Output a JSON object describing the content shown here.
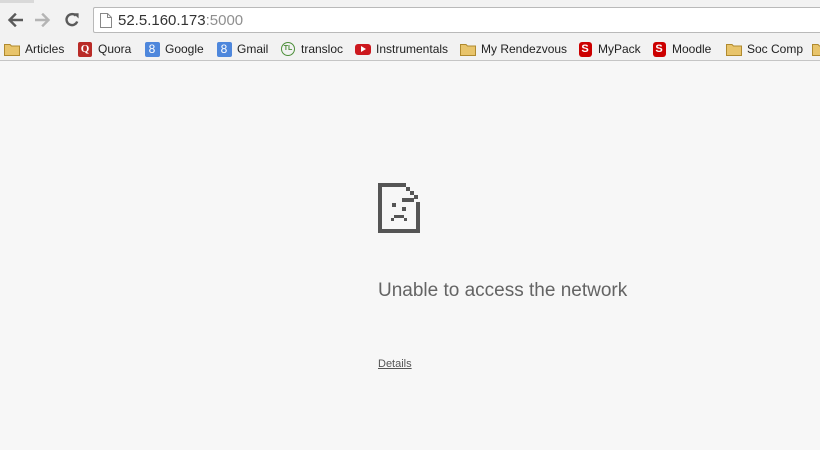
{
  "address_bar": {
    "url_host": "52.5.160.173",
    "url_port": ":5000"
  },
  "bookmarks": [
    {
      "label": "Articles",
      "icon": "folder-icon"
    },
    {
      "label": "Quora",
      "icon": "quora-icon",
      "glyph": "Q"
    },
    {
      "label": "Google",
      "icon": "google-icon",
      "glyph": "8"
    },
    {
      "label": "Gmail",
      "icon": "google-icon",
      "glyph": "8"
    },
    {
      "label": "transloc",
      "icon": "transloc-icon",
      "glyph": "TL"
    },
    {
      "label": "Instrumentals",
      "icon": "youtube-icon"
    },
    {
      "label": "My Rendezvous",
      "icon": "folder-icon"
    },
    {
      "label": "MyPack",
      "icon": "ncsu-icon",
      "glyph": "S"
    },
    {
      "label": "Moodle",
      "icon": "ncsu-icon",
      "glyph": "S"
    },
    {
      "label": "Soc Comp",
      "icon": "folder-icon"
    }
  ],
  "error": {
    "heading": "Unable to access the network",
    "details_link": "Details"
  },
  "colors": {
    "page_background": "#f7f7f7",
    "toolbar_background": "#f2f2f2",
    "error_text": "#646464",
    "folder_icon": "#e8c46b"
  }
}
